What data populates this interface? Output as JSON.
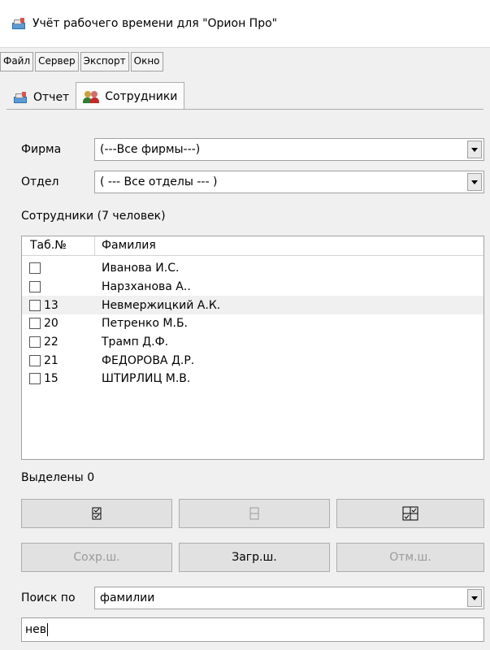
{
  "window": {
    "title": "Учёт рабочего времени для \"Орион Про\"",
    "icon": "app-icon"
  },
  "menu": [
    "Файл",
    "Сервер",
    "Экспорт",
    "Окно"
  ],
  "tabs": [
    {
      "label": "Отчет",
      "icon": "report-icon",
      "active": false
    },
    {
      "label": "Сотрудники",
      "icon": "people-icon",
      "active": true
    }
  ],
  "filters": {
    "firm_label": "Фирма",
    "firm_value": "(---Все фирмы---)",
    "dept_label": "Отдел",
    "dept_value": "( --- Все отделы --- )"
  },
  "employees": {
    "caption": "Сотрудники (7 человек)",
    "columns": [
      "Таб.№",
      "Фамилия"
    ],
    "rows": [
      {
        "tab": "",
        "name": "Иванова И.С.",
        "checked": false,
        "selected": false
      },
      {
        "tab": "",
        "name": "Нарзханова А..",
        "checked": false,
        "selected": false
      },
      {
        "tab": "13",
        "name": "Невмержицкий А.К.",
        "checked": false,
        "selected": true
      },
      {
        "tab": "20",
        "name": "Петренко М.Б.",
        "checked": false,
        "selected": false
      },
      {
        "tab": "22",
        "name": "Трамп Д.Ф.",
        "checked": false,
        "selected": false
      },
      {
        "tab": "21",
        "name": "ФЕДОРОВА Д.Р.",
        "checked": false,
        "selected": false
      },
      {
        "tab": "15",
        "name": "ШТИРЛИЦ М.В.",
        "checked": false,
        "selected": false
      }
    ]
  },
  "selection": {
    "label": "Выделены",
    "count": "0"
  },
  "buttons": {
    "select_all_icon": "check-all-icon",
    "deselect_all_icon": "uncheck-all-icon",
    "invert_icon": "invert-selection-icon",
    "save_template": "Сохр.ш.",
    "load_template": "Загр.ш.",
    "cancel_template": "Отм.ш."
  },
  "search": {
    "label": "Поиск по",
    "mode": "фамилии",
    "query": "нев"
  },
  "colors": {
    "background": "#f0f0f0",
    "selected_row": "#f0f0f0",
    "disabled_text": "#9a9a9a"
  }
}
